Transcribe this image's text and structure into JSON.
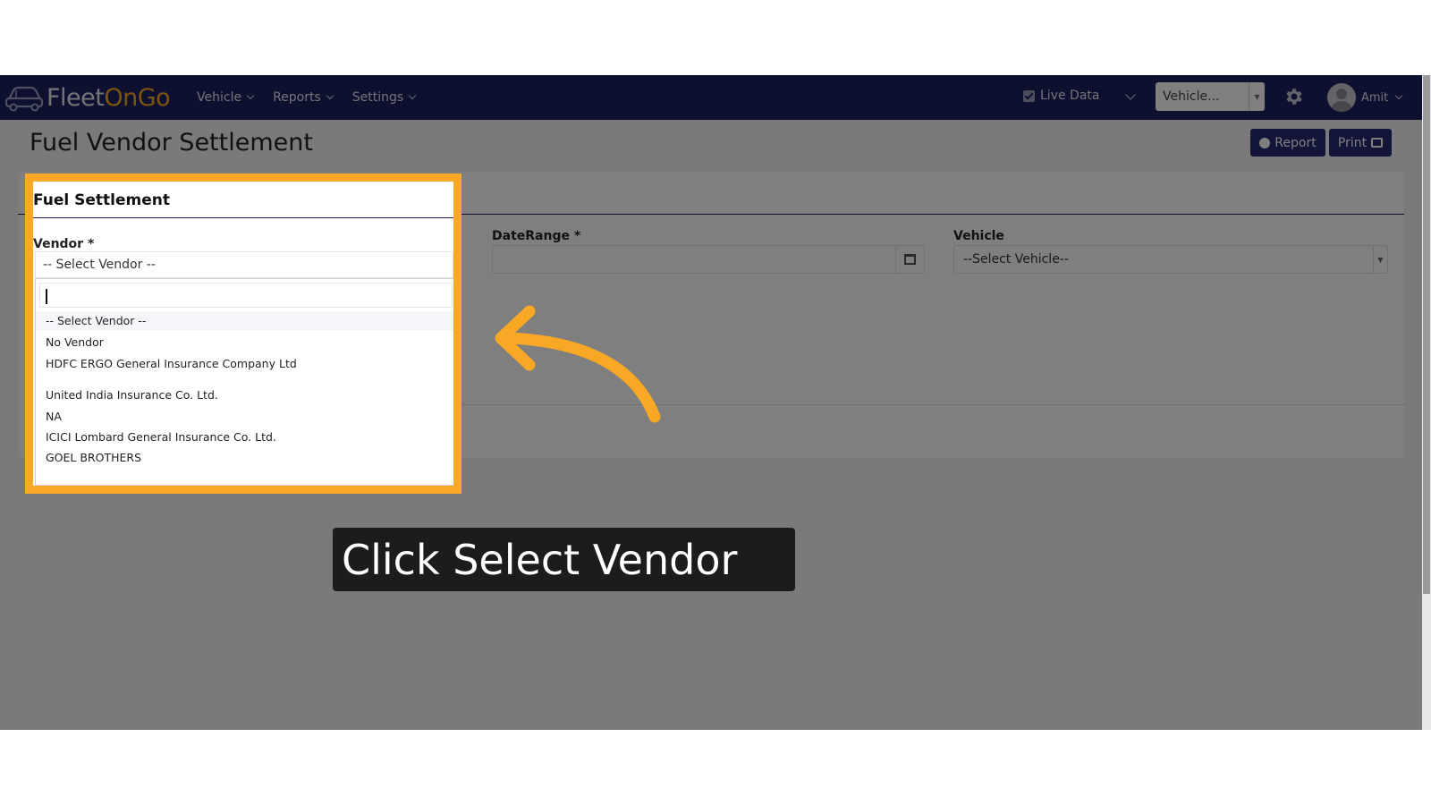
{
  "brand": {
    "name_part1": "Fleet",
    "name_part2": "On",
    "name_part3": "Go"
  },
  "nav": {
    "items": [
      {
        "label": "Vehicle"
      },
      {
        "label": "Reports"
      },
      {
        "label": "Settings"
      }
    ],
    "live_data_label": "Live Data",
    "vehicle_select_value": "Vehicle...",
    "user_name": "Amit"
  },
  "page": {
    "title": "Fuel Vendor Settlement",
    "report_button": "Report",
    "print_button": "Print"
  },
  "form": {
    "card_title": "Fuel Settlement",
    "vendor_label": "Vendor *",
    "vendor_selected": "-- Select Vendor --",
    "daterange_label": "DateRange *",
    "daterange_value": "",
    "vehicle_label": "Vehicle",
    "vehicle_selected": "--Select Vehicle--"
  },
  "vendor_dropdown": {
    "search_value": "",
    "options": [
      "-- Select Vendor --",
      "No Vendor",
      "HDFC ERGO General Insurance Company Ltd",
      "United India Insurance Co. Ltd.",
      "NA",
      "ICICI Lombard General Insurance Co. Ltd.",
      "GOEL BROTHERS"
    ]
  },
  "tutorial": {
    "caption": "Click Select Vendor",
    "highlight_color": "#f9a825",
    "arrow_color": "#f9a825"
  },
  "colors": {
    "navbar": "#1d2060",
    "accent": "#f5a623",
    "button": "#252a6e"
  }
}
